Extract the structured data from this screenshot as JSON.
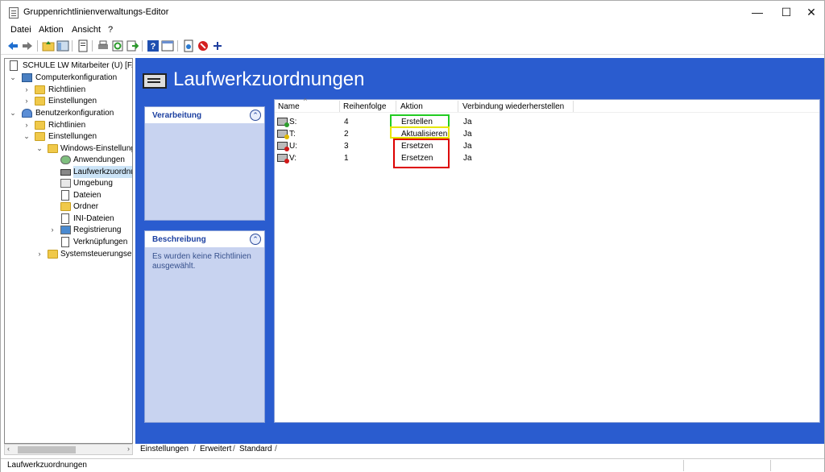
{
  "window": {
    "title": "Gruppenrichtlinienverwaltungs-Editor",
    "min_glyph": "—",
    "max_glyph": "☐",
    "close_glyph": "✕"
  },
  "menu": {
    "file": "Datei",
    "action": "Aktion",
    "view": "Ansicht",
    "help": "?"
  },
  "toolbar": {
    "icons": [
      "back-icon",
      "forward-icon",
      "up-folder-icon",
      "show-tree-icon",
      "properties-icon",
      "print-icon",
      "refresh-icon",
      "export-icon",
      "help-icon",
      "details-view-icon",
      "new-item-icon",
      "delete-icon",
      "add-icon"
    ]
  },
  "tree": {
    "root": "SCHULE LW Mitarbeiter (U) [FAU",
    "computer_config": "Computerkonfiguration",
    "cc_policies": "Richtlinien",
    "cc_preferences": "Einstellungen",
    "user_config": "Benutzerkonfiguration",
    "uc_policies": "Richtlinien",
    "uc_preferences": "Einstellungen",
    "windows_settings": "Windows-Einstellung",
    "applications": "Anwendungen",
    "drive_maps": "Laufwerkzuordnu",
    "environment": "Umgebung",
    "files": "Dateien",
    "folders": "Ordner",
    "ini_files": "INI-Dateien",
    "registry": "Registrierung",
    "shortcuts": "Verknüpfungen",
    "control_panel": "Systemsteuerungseir"
  },
  "main": {
    "title": "Laufwerkzuordnungen",
    "processing_title": "Verarbeitung",
    "description_title": "Beschreibung",
    "description_text": "Es wurden keine Richtlinien ausgewählt."
  },
  "list": {
    "columns": [
      "Name",
      "Reihenfolge",
      "Aktion",
      "Verbindung wiederherstellen"
    ],
    "rows": [
      {
        "name": "S:",
        "order": "4",
        "action": "Erstellen",
        "reconnect": "Ja",
        "status_color": "#2e9e2e"
      },
      {
        "name": "T:",
        "order": "2",
        "action": "Aktualisieren",
        "reconnect": "Ja",
        "status_color": "#e0b800"
      },
      {
        "name": "U:",
        "order": "3",
        "action": "Ersetzen",
        "reconnect": "Ja",
        "status_color": "#d01818"
      },
      {
        "name": "V:",
        "order": "1",
        "action": "Ersetzen",
        "reconnect": "Ja",
        "status_color": "#d01818"
      }
    ],
    "highlight_colors": {
      "create": "#22cc22",
      "update": "#e6e600",
      "replace": "#dd0000"
    }
  },
  "tabs": {
    "settings": "Einstellungen",
    "extended": "Erweitert",
    "standard": "Standard"
  },
  "status": {
    "text": "Laufwerkzuordnungen"
  },
  "colors": {
    "main_bg": "#2a5ccf",
    "panel_title": "#1b3fa0",
    "selection": "#cce4f7"
  }
}
